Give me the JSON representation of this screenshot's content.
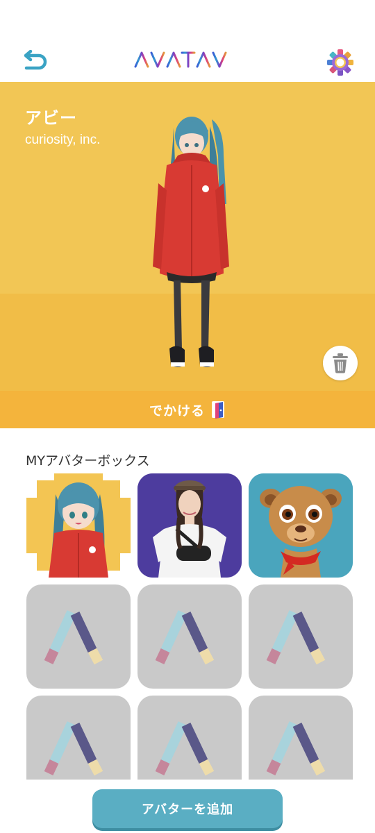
{
  "header": {
    "logo_text": "AVATAVI",
    "back_icon": "back-arrow-icon",
    "settings_icon": "gear-icon"
  },
  "hero": {
    "avatar_name": "アビー",
    "company": "curiosity, inc.",
    "bg_color": "#f2c655",
    "trash_icon": "trash-icon"
  },
  "go_button": {
    "label": "でかける",
    "icon": "door-icon",
    "color": "#f4b43c"
  },
  "avatar_box": {
    "title": "MYアバターボックス",
    "items": [
      {
        "kind": "anime-girl",
        "bg": "#f3c553"
      },
      {
        "kind": "photo-woman",
        "bg": "#4d3c9e"
      },
      {
        "kind": "lion-cub",
        "bg": "#4aa5bd"
      },
      {
        "kind": "empty"
      },
      {
        "kind": "empty"
      },
      {
        "kind": "empty"
      },
      {
        "kind": "empty"
      },
      {
        "kind": "empty"
      },
      {
        "kind": "empty"
      }
    ]
  },
  "add_button": {
    "label": "アバターを追加",
    "color": "#5aaec3"
  }
}
